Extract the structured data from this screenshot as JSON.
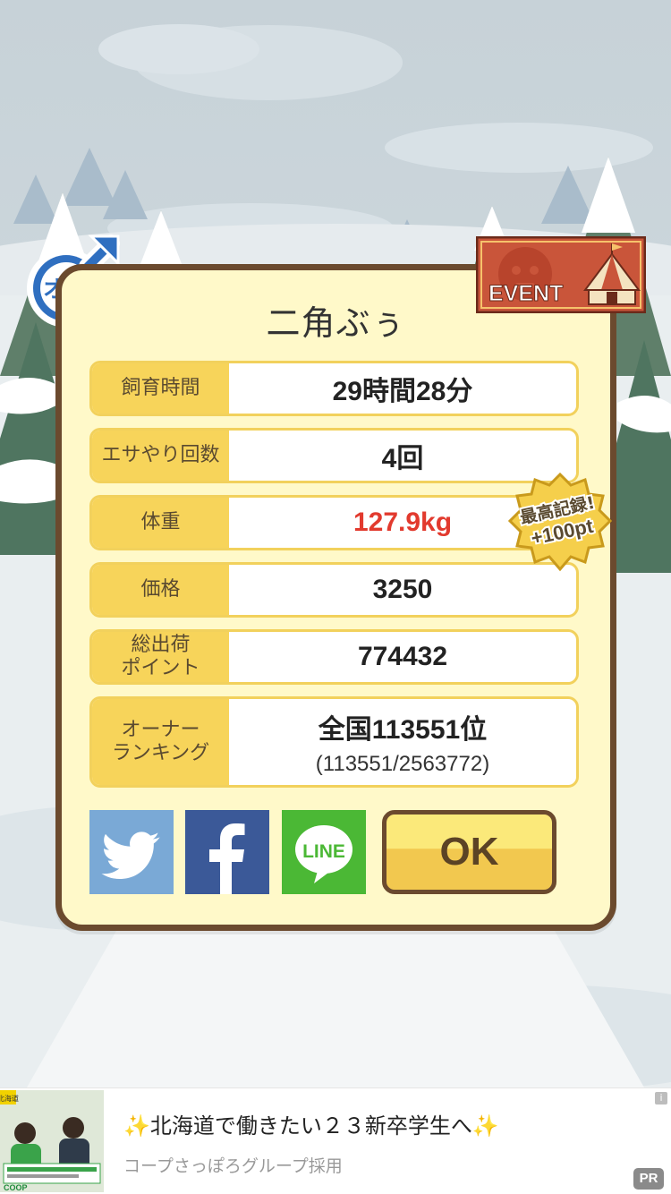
{
  "pig_name": "二角ぶぅ",
  "gender_badge_text": "オス",
  "event_badge_text": "EVENT",
  "record_badge": {
    "line1": "最高記録!",
    "line2": "+100pt"
  },
  "stats": [
    {
      "label": "飼育時間",
      "value": "29時間28分"
    },
    {
      "label": "エサやり回数",
      "value": "4回"
    },
    {
      "label": "体重",
      "value": "127.9kg"
    },
    {
      "label": "価格",
      "value": "3250"
    },
    {
      "label_line1": "総出荷",
      "label_line2": "ポイント",
      "value": "774432"
    },
    {
      "label_line1": "オーナー",
      "label_line2": "ランキング",
      "value": "全国113551位",
      "sub": "(113551/2563772)"
    }
  ],
  "share": {
    "twitter_icon": "twitter-bird-icon",
    "facebook_icon": "facebook-f-icon",
    "line_label": "LINE"
  },
  "ok_label": "OK",
  "ad": {
    "title": "北海道で働きたい２３新卒学生へ",
    "sparkle": "✨",
    "subtitle": "コープさっぽろグループ採用",
    "info": "i",
    "pr": "PR",
    "thumb_tag": "北海道",
    "thumb_logo": "COOP"
  },
  "colors": {
    "panel_bg": "#fff9c9",
    "panel_border": "#6b4a2e",
    "label_bg": "#f7d45a",
    "weight_red": "#e23a2e",
    "twitter": "#7aa9d6",
    "facebook": "#3b5998",
    "line": "#4bb835"
  }
}
